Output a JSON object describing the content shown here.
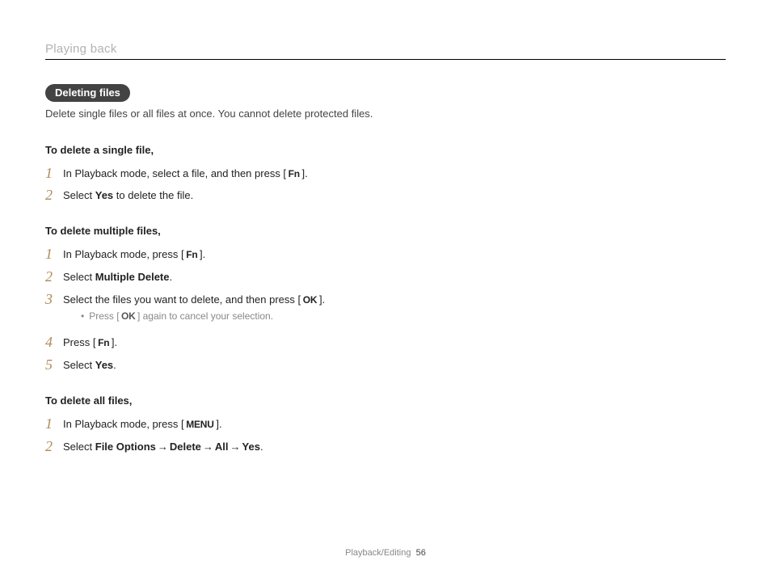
{
  "chapter": "Playing back",
  "section_pill": "Deleting files",
  "intro": "Delete single files or all files at once. You cannot delete protected files.",
  "keys": {
    "fn": "Fn",
    "ok": "OK",
    "menu": "MENU"
  },
  "subhead1": "To delete a single file,",
  "single": {
    "s1_a": "In Playback mode, select a file, and then press [ ",
    "s1_b": " ].",
    "s2_a": "Select ",
    "s2_yes": "Yes",
    "s2_b": " to delete the file."
  },
  "subhead2": "To delete multiple files,",
  "multi": {
    "s1_a": "In Playback mode, press [ ",
    "s1_b": " ].",
    "s2_a": "Select ",
    "s2_bold": "Multiple Delete",
    "s2_b": ".",
    "s3_a": "Select the files you want to delete, and then press [ ",
    "s3_b": " ].",
    "s3_sub_a": "Press [ ",
    "s3_sub_b": " ] again to cancel your selection.",
    "s4_a": "Press [ ",
    "s4_b": " ].",
    "s5_a": "Select ",
    "s5_yes": "Yes",
    "s5_b": "."
  },
  "subhead3": "To delete all files,",
  "all": {
    "s1_a": "In Playback mode, press [ ",
    "s1_b": " ].",
    "s2_a": "Select ",
    "s2_fo": "File Options",
    "s2_del": "Delete",
    "s2_all": "All",
    "s2_yes": "Yes",
    "s2_dot": "."
  },
  "nums": {
    "n1": "1",
    "n2": "2",
    "n3": "3",
    "n4": "4",
    "n5": "5"
  },
  "arrow": "→",
  "bullet": "•",
  "footer_section": "Playback/Editing",
  "page_number": "56"
}
